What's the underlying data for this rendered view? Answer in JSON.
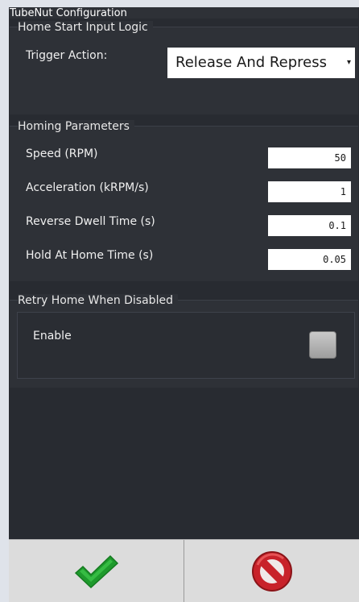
{
  "window": {
    "title": "TubeNut Configuration"
  },
  "home_start": {
    "section_title": "Home Start Input Logic",
    "trigger_label": "Trigger Action:",
    "trigger_value": "Release And Repress",
    "trigger_arrow": "▾"
  },
  "homing": {
    "section_title": "Homing Parameters",
    "fields": [
      {
        "label": "Speed (RPM)",
        "value": "50"
      },
      {
        "label": "Acceleration (kRPM/s)",
        "value": "1"
      },
      {
        "label": "Reverse Dwell Time (s)",
        "value": "0.1"
      },
      {
        "label": "Hold At Home Time (s)",
        "value": "0.05"
      }
    ]
  },
  "retry": {
    "section_title": "Retry Home When Disabled",
    "enable_label": "Enable",
    "enable_checked": false
  },
  "footer": {
    "ok_icon": "green-checkmark-icon",
    "cancel_icon": "red-cancel-icon"
  },
  "colors": {
    "panel_bg": "#282b31",
    "section_bg": "#2e3137",
    "ok_green": "#20a030",
    "cancel_red": "#d02828"
  }
}
